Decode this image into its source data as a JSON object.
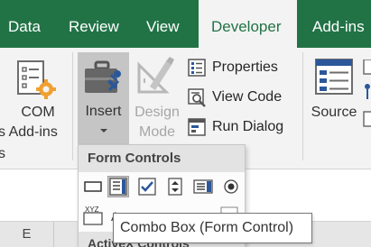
{
  "tabs": [
    {
      "label": "Data"
    },
    {
      "label": "Review"
    },
    {
      "label": "View"
    },
    {
      "label": "Developer",
      "active": true
    },
    {
      "label": "Add-ins"
    }
  ],
  "ribbon": {
    "com_addins": {
      "line1": "COM",
      "line2": "s Add-ins",
      "line3": "s"
    },
    "insert": {
      "label": "Insert"
    },
    "design_mode": {
      "line1": "Design",
      "line2": "Mode"
    },
    "properties": {
      "label": "Properties"
    },
    "view_code": {
      "label": "View Code"
    },
    "run_dialog": {
      "label": "Run Dialog"
    },
    "source": {
      "label": "Source"
    }
  },
  "dropdown": {
    "header": "Form Controls",
    "controls": [
      {
        "name": "button-control-icon"
      },
      {
        "name": "combo-box-control-icon",
        "selected": true
      },
      {
        "name": "check-box-control-icon"
      },
      {
        "name": "spin-button-control-icon"
      },
      {
        "name": "list-box-control-icon"
      },
      {
        "name": "option-button-control-icon"
      }
    ],
    "section2_label": "ActiveX Controls"
  },
  "column_header": {
    "label": "E"
  },
  "tooltip": {
    "text": "Combo Box (Form Control)"
  },
  "colors": {
    "accent": "#217346",
    "ribbon_bg": "#f3f3f3",
    "dropdown_header_bg": "#e3e3e3",
    "icon_blue": "#2b579a"
  }
}
